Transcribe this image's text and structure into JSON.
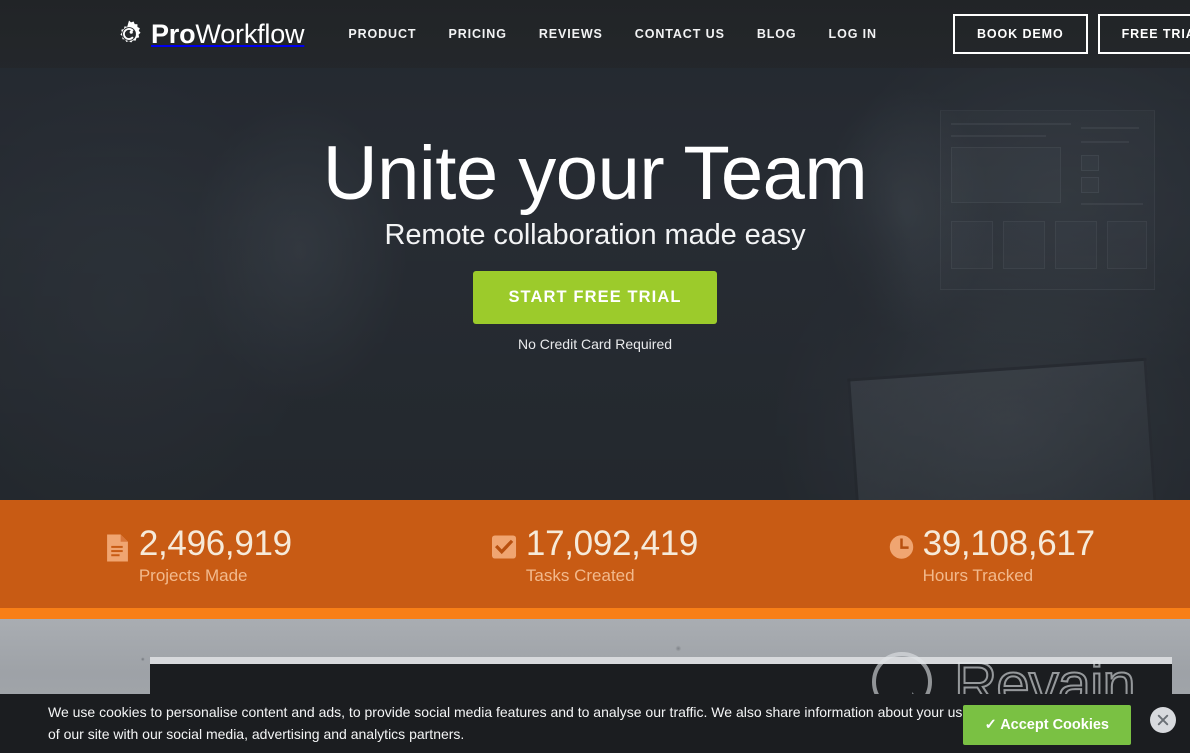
{
  "header": {
    "logo": {
      "icon": "gear-icon",
      "bold_part": "Pro",
      "light_part": "Workflow"
    },
    "nav": [
      {
        "label": "PRODUCT"
      },
      {
        "label": "PRICING"
      },
      {
        "label": "REVIEWS"
      },
      {
        "label": "CONTACT US"
      },
      {
        "label": "BLOG"
      },
      {
        "label": "LOG IN"
      }
    ],
    "buttons": [
      {
        "label": "BOOK DEMO"
      },
      {
        "label": "FREE TRIAL"
      }
    ]
  },
  "hero": {
    "headline": "Unite your Team",
    "subheadline": "Remote collaboration made easy",
    "cta_label": "START FREE TRIAL",
    "cta_note": "No Credit Card Required",
    "cta_color": "#9ccb2b"
  },
  "stats": {
    "background_color": "#c85b14",
    "stripe_color": "#f87f17",
    "items": [
      {
        "icon": "document-icon",
        "value": "2,496,919",
        "label": "Projects Made"
      },
      {
        "icon": "checkbox-icon",
        "value": "17,092,419",
        "label": "Tasks Created"
      },
      {
        "icon": "clock-icon",
        "value": "39,108,617",
        "label": "Hours Tracked"
      }
    ]
  },
  "watermark": {
    "text": "Revain",
    "icon": "revain-logo-icon"
  },
  "cookie_banner": {
    "message": "We use cookies to personalise content and ads, to provide social media features and to analyse our traffic. We also share information about your use of our site with our social media, advertising and analytics partners.",
    "accept_label": "✓ Accept Cookies",
    "accept_color": "#7ac143",
    "close_icon": "close-icon"
  }
}
